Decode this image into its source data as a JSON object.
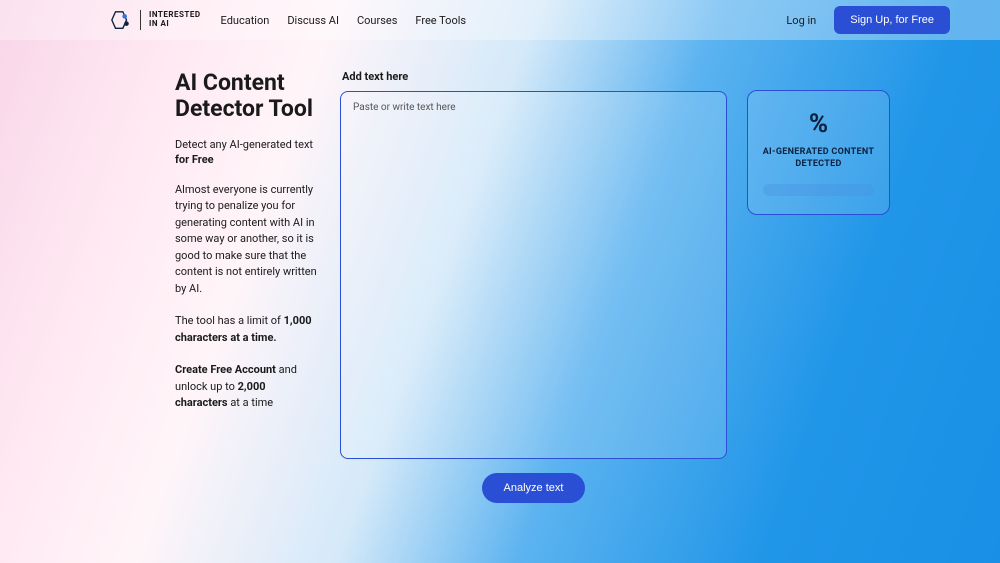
{
  "header": {
    "logo_text_line1": "INTERESTED",
    "logo_text_line2": "IN AI",
    "nav": [
      "Education",
      "Discuss AI",
      "Courses",
      "Free Tools"
    ],
    "login": "Log in",
    "signup": "Sign Up, for Free"
  },
  "left": {
    "title": "AI Content Detector Tool",
    "subtitle_pre": "Detect any AI-generated text ",
    "subtitle_bold": "for Free",
    "description": "Almost everyone is currently trying to penalize you for generating content with AI in some way or another, so it is good to make sure that the content is not entirely written by AI.",
    "limit_pre": "The tool has a limit of ",
    "limit_bold": "1,000 characters at a time.",
    "create_bold1": "Create Free Account",
    "create_mid": " and unlock up to ",
    "create_bold2": "2,000 characters",
    "create_post": " at a time"
  },
  "center": {
    "label": "Add text here",
    "placeholder": "Paste or write text here",
    "analyze": "Analyze text"
  },
  "result": {
    "percent": "%",
    "label": "AI-GENERATED CONTENT DETECTED"
  }
}
